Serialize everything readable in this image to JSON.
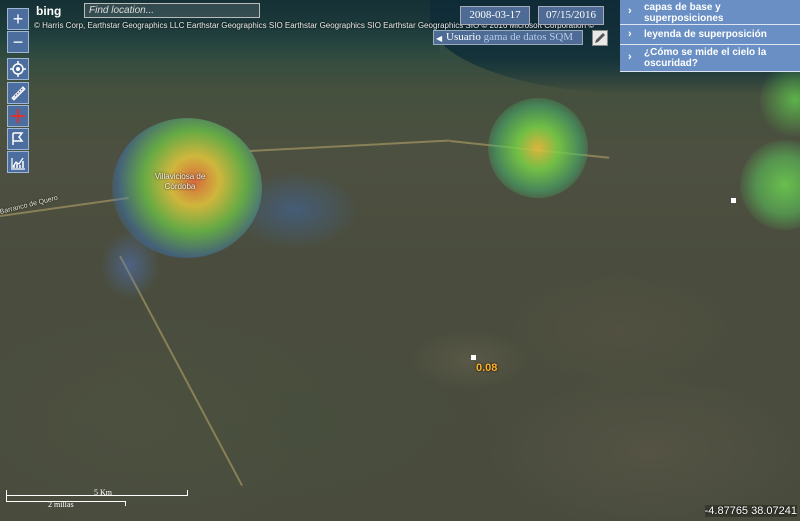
{
  "map": {
    "city_label_line1": "Villaviciosa de",
    "city_label_line2": "Córdoba",
    "street_label": "Barranco de Quero",
    "reading_value": "0.08",
    "attribution": "© Harris Corp, Earthstar Geographics LLC Earthstar Geographics SIO Earthstar Geographics SIO Earthstar Geographics SIO © 2016 Microsoft Corporation ©"
  },
  "search": {
    "brand": "bing",
    "placeholder": "Find location..."
  },
  "dates": {
    "start": "2008-03-17",
    "end": "07/15/2016"
  },
  "user_select": {
    "prefix": "Usuario ",
    "option": "gama de datos SQM"
  },
  "panel": {
    "items": [
      {
        "label": "capas de base y superposiciones"
      },
      {
        "label": "leyenda de superposición"
      },
      {
        "label": "¿Cómo se mide el cielo la oscuridad?"
      }
    ]
  },
  "scale": {
    "km": "5 Km",
    "miles": "2 millas"
  },
  "coordinates": "-4.87765 38.07241",
  "colors": {
    "panel": "#6a8fc4",
    "control": "#4c6e9e",
    "reading": "#ffb020"
  },
  "icons": [
    "zoom-in-icon",
    "zoom-out-icon",
    "locate-icon",
    "ruler-icon",
    "crosshair-icon",
    "flag-icon",
    "chart-icon",
    "chevron-right-icon",
    "pencil-icon"
  ]
}
